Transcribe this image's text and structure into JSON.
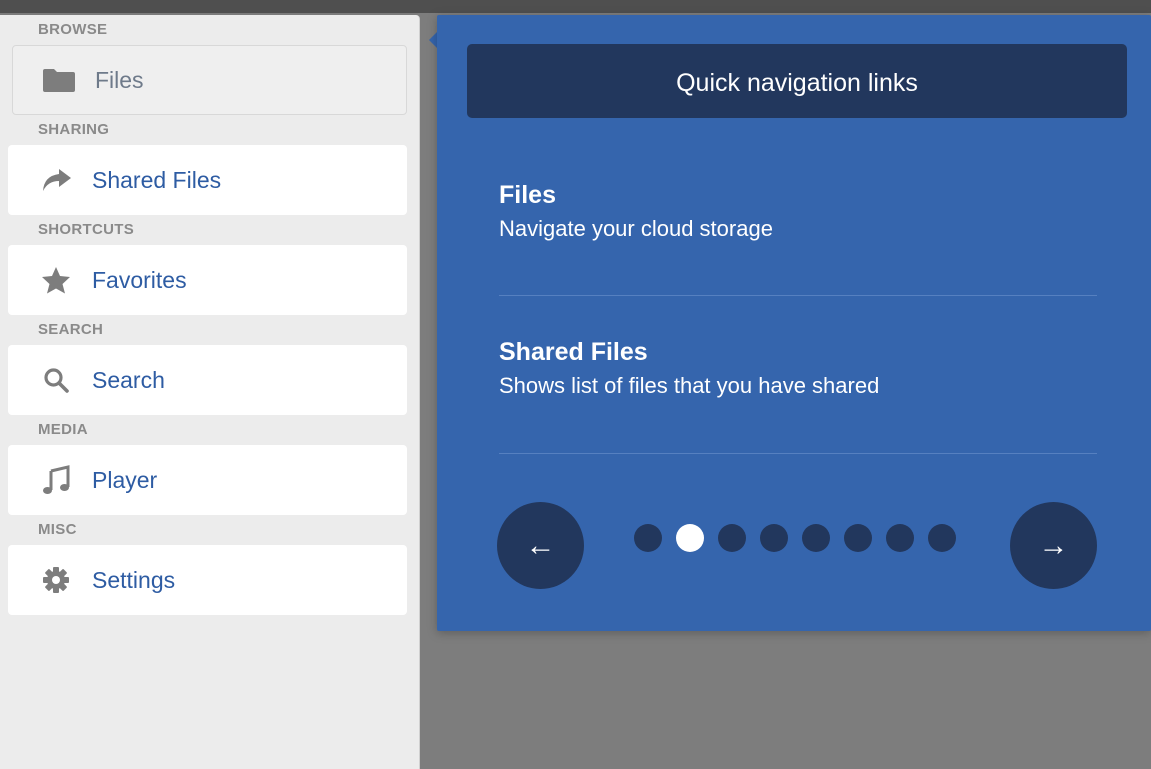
{
  "sidebar": {
    "sections": [
      {
        "header": "BROWSE",
        "item": {
          "label": "Files",
          "icon": "folder-icon",
          "active": true
        }
      },
      {
        "header": "SHARING",
        "item": {
          "label": "Shared Files",
          "icon": "share-icon",
          "active": false
        }
      },
      {
        "header": "SHORTCUTS",
        "item": {
          "label": "Favorites",
          "icon": "star-icon",
          "active": false
        }
      },
      {
        "header": "SEARCH",
        "item": {
          "label": "Search",
          "icon": "search-icon",
          "active": false
        }
      },
      {
        "header": "MEDIA",
        "item": {
          "label": "Player",
          "icon": "music-note-icon",
          "active": false
        }
      },
      {
        "header": "MISC",
        "item": {
          "label": "Settings",
          "icon": "gear-icon",
          "active": false
        }
      }
    ]
  },
  "tour": {
    "title": "Quick navigation links",
    "links": [
      {
        "title": "Files",
        "description": "Navigate your cloud storage"
      },
      {
        "title": "Shared Files",
        "description": "Shows list of files that you have shared"
      }
    ],
    "prev_label": "←",
    "next_label": "→",
    "page_count": 8,
    "current_page": 2
  },
  "colors": {
    "panel_blue": "#3565ad",
    "dark_navy": "#22375d",
    "link_blue": "#2e5ca3",
    "sidebar_bg": "#ececec"
  }
}
